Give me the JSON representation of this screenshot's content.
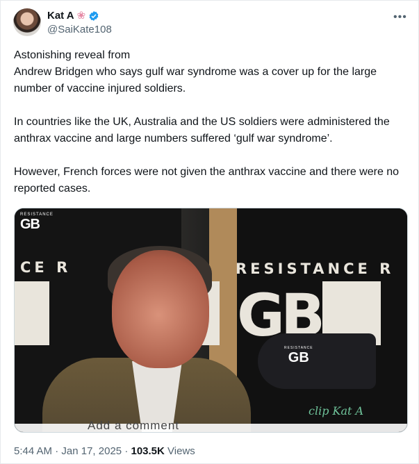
{
  "author": {
    "display_name": "Kat A",
    "flower_icon": "❀",
    "verified": true,
    "handle": "@SaiKate108",
    "more_label": "•••"
  },
  "tweet": {
    "paragraphs": [
      "Astonishing reveal from\nAndrew Bridgen who says gulf war syndrome was a cover up for the large number of vaccine injured soldiers.",
      "In countries like the UK, Australia and the US soldiers were administered the anthrax vaccine and large numbers suffered ‘gulf war syndrome’.",
      "However, French forces were not given the anthrax vaccine and there were no reported cases."
    ]
  },
  "media": {
    "logo_small_top": "RESISTANCE",
    "logo_small_main": "GB",
    "wall_resistance": "RESISTANCE R",
    "wall_cer": "CE R",
    "wall_ce": "CE",
    "wall_gb": "GB",
    "mic_top": "RESISTANCE",
    "mic_main": "GB",
    "watermark": "clip Kat A",
    "caption": "Add a comment"
  },
  "meta": {
    "time": "5:44 AM",
    "date": "Jan 17, 2025",
    "views_count": "103.5K",
    "views_label": "Views"
  },
  "colors": {
    "text": "#0f1419",
    "secondary": "#536471",
    "verified_blue": "#1d9bf0"
  }
}
